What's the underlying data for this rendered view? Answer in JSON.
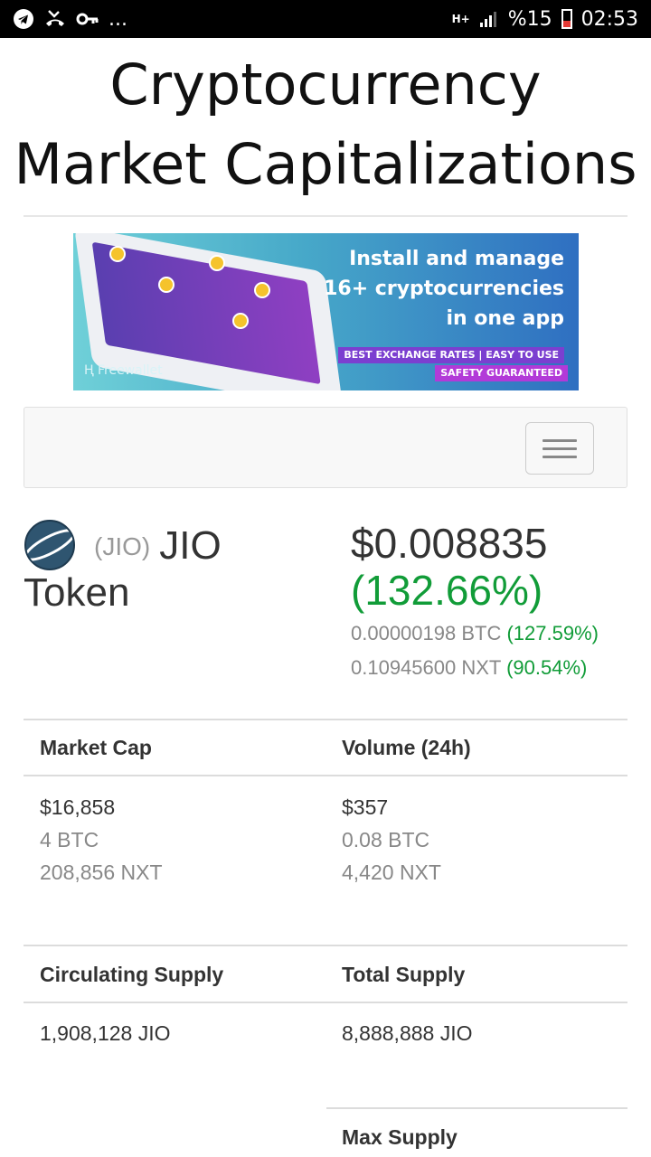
{
  "status_bar": {
    "left_icons": [
      "telegram-icon",
      "missed-call-icon",
      "key-icon",
      "more-icon"
    ],
    "overflow": "...",
    "network": "H+",
    "battery_percent": "%15",
    "time": "02:53"
  },
  "page": {
    "title_line1": "Cryptocurrency",
    "title_line2": "Market Capitalizations"
  },
  "ad": {
    "headline_line1": "Install and manage",
    "headline_line2": "16+ cryptocurrencies",
    "headline_line3": "in one app",
    "tagline1": "BEST EXCHANGE RATES  |  EASY TO USE",
    "tagline2": "SAFETY GUARANTEED",
    "brand": "Freewallet"
  },
  "coin": {
    "symbol": "(JIO)",
    "name_part1": "JIO",
    "name_part2": "Token",
    "price_usd": "$0.008835",
    "change_usd": "(132.66%)",
    "price_btc": "0.00000198 BTC",
    "change_btc": "(127.59%)",
    "price_nxt": "0.10945600 NXT",
    "change_nxt": "(90.54%)",
    "colors": {
      "positive": "#119c38",
      "logo": "#2f5570"
    }
  },
  "stats": {
    "market_cap": {
      "label": "Market Cap",
      "usd": "$16,858",
      "btc": "4 BTC",
      "nxt": "208,856 NXT"
    },
    "volume": {
      "label": "Volume (24h)",
      "usd": "$357",
      "btc": "0.08 BTC",
      "nxt": "4,420 NXT"
    },
    "circulating_supply": {
      "label": "Circulating Supply",
      "value": "1,908,128 JIO"
    },
    "total_supply": {
      "label": "Total Supply",
      "value": "8,888,888 JIO"
    },
    "max_supply": {
      "label": "Max Supply"
    }
  }
}
